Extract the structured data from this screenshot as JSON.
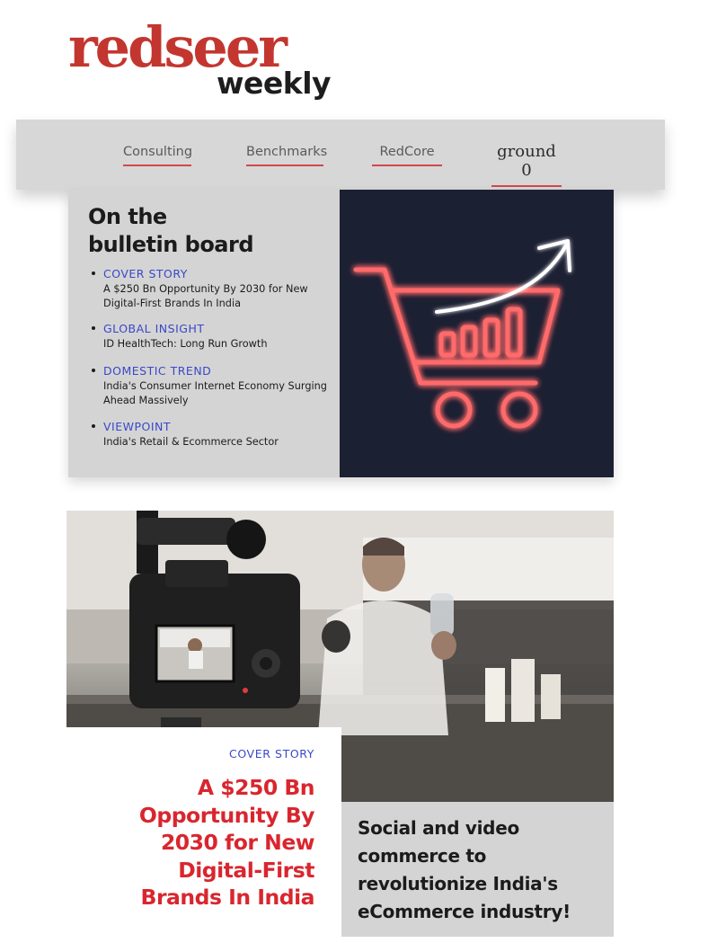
{
  "brand": {
    "name": "redseer",
    "sub": "weekly",
    "color": "#c3362f"
  },
  "nav": {
    "items": [
      {
        "label": "Consulting"
      },
      {
        "label": "Benchmarks"
      },
      {
        "label": "RedCore"
      },
      {
        "label": "ground 0"
      }
    ],
    "underline_color": "#d2484a"
  },
  "bulletin": {
    "title_line1": "On the",
    "title_line2": "bulletin board",
    "items": [
      {
        "tag": "COVER STORY",
        "text": "A $250 Bn Opportunity By 2030 for New Digital-First Brands In India"
      },
      {
        "tag": "GLOBAL INSIGHT",
        "text": "ID HealthTech: Long Run Growth"
      },
      {
        "tag": "DOMESTIC TREND",
        "text": "India's Consumer Internet Economy Surging Ahead Massively"
      },
      {
        "tag": "VIEWPOINT",
        "text": "India's Retail & Ecommerce Sector"
      }
    ],
    "tag_color": "#3a48c8",
    "illustration_icon": "neon-shopping-cart-growth-icon"
  },
  "cover": {
    "tag": "COVER STORY",
    "headline": "A $250 Bn Opportunity By 2030 for New Digital-First Brands In India",
    "subhead": "Social and video commerce to revolutionize India's eCommerce industry!",
    "headline_color": "#d9262e",
    "photo_icon": "camera-recording-influencer-photo"
  }
}
